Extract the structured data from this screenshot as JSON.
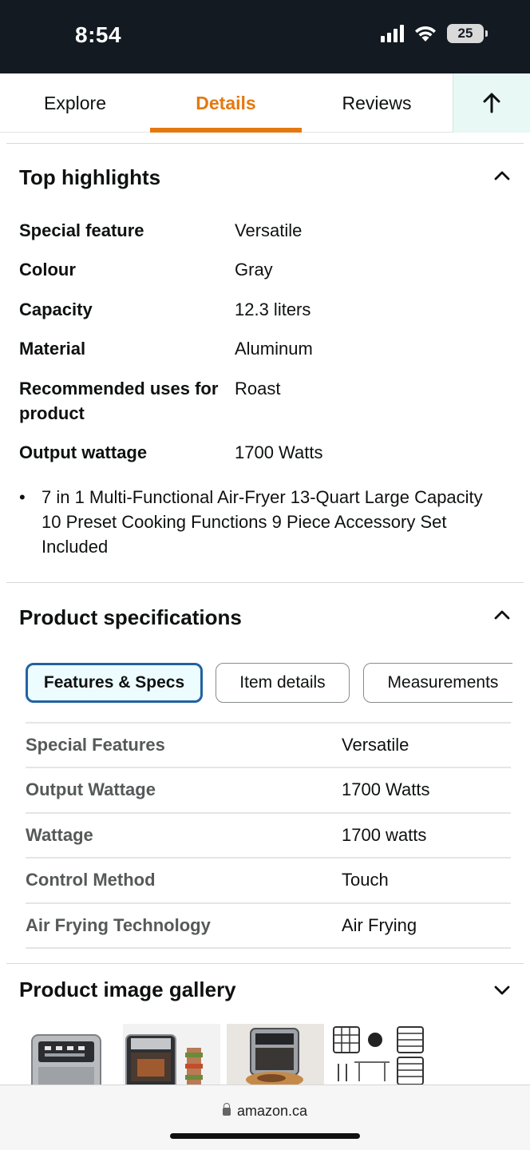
{
  "status_bar": {
    "time": "8:54",
    "battery": "25",
    "icons": [
      "cellular-signal-icon",
      "wifi-icon",
      "battery-icon"
    ]
  },
  "tabs": {
    "items": [
      {
        "label": "Explore"
      },
      {
        "label": "Details",
        "active": true
      },
      {
        "label": "Reviews"
      }
    ],
    "back_to_top_icon": "arrow-up-icon"
  },
  "highlights": {
    "title": "Top highlights",
    "rows": [
      {
        "key": "Special feature",
        "value": "Versatile"
      },
      {
        "key": "Colour",
        "value": "Gray"
      },
      {
        "key": "Capacity",
        "value": "12.3 liters"
      },
      {
        "key": "Material",
        "value": "Aluminum"
      },
      {
        "key": "Recommended uses for product",
        "value": "Roast"
      },
      {
        "key": "Output wattage",
        "value": "1700 Watts"
      }
    ],
    "bullet": "7 in 1 Multi-Functional Air-Fryer 13-Quart Large Capacity 10 Preset Cooking Functions 9 Piece Accessory Set Included"
  },
  "specifications": {
    "title": "Product specifications",
    "chips": [
      {
        "label": "Features & Specs",
        "selected": true
      },
      {
        "label": "Item details"
      },
      {
        "label": "Measurements"
      }
    ],
    "rows": [
      {
        "key": "Special Features",
        "value": "Versatile"
      },
      {
        "key": "Output Wattage",
        "value": "1700 Watts"
      },
      {
        "key": "Wattage",
        "value": "1700 watts"
      },
      {
        "key": "Control Method",
        "value": "Touch"
      },
      {
        "key": "Air Frying Technology",
        "value": "Air Frying"
      }
    ]
  },
  "gallery": {
    "title": "Product image gallery"
  },
  "browser": {
    "url": "amazon.ca"
  },
  "colors": {
    "accent": "#e47911",
    "chip_selected_border": "#2162a1",
    "status_bar_bg": "#131a22"
  }
}
